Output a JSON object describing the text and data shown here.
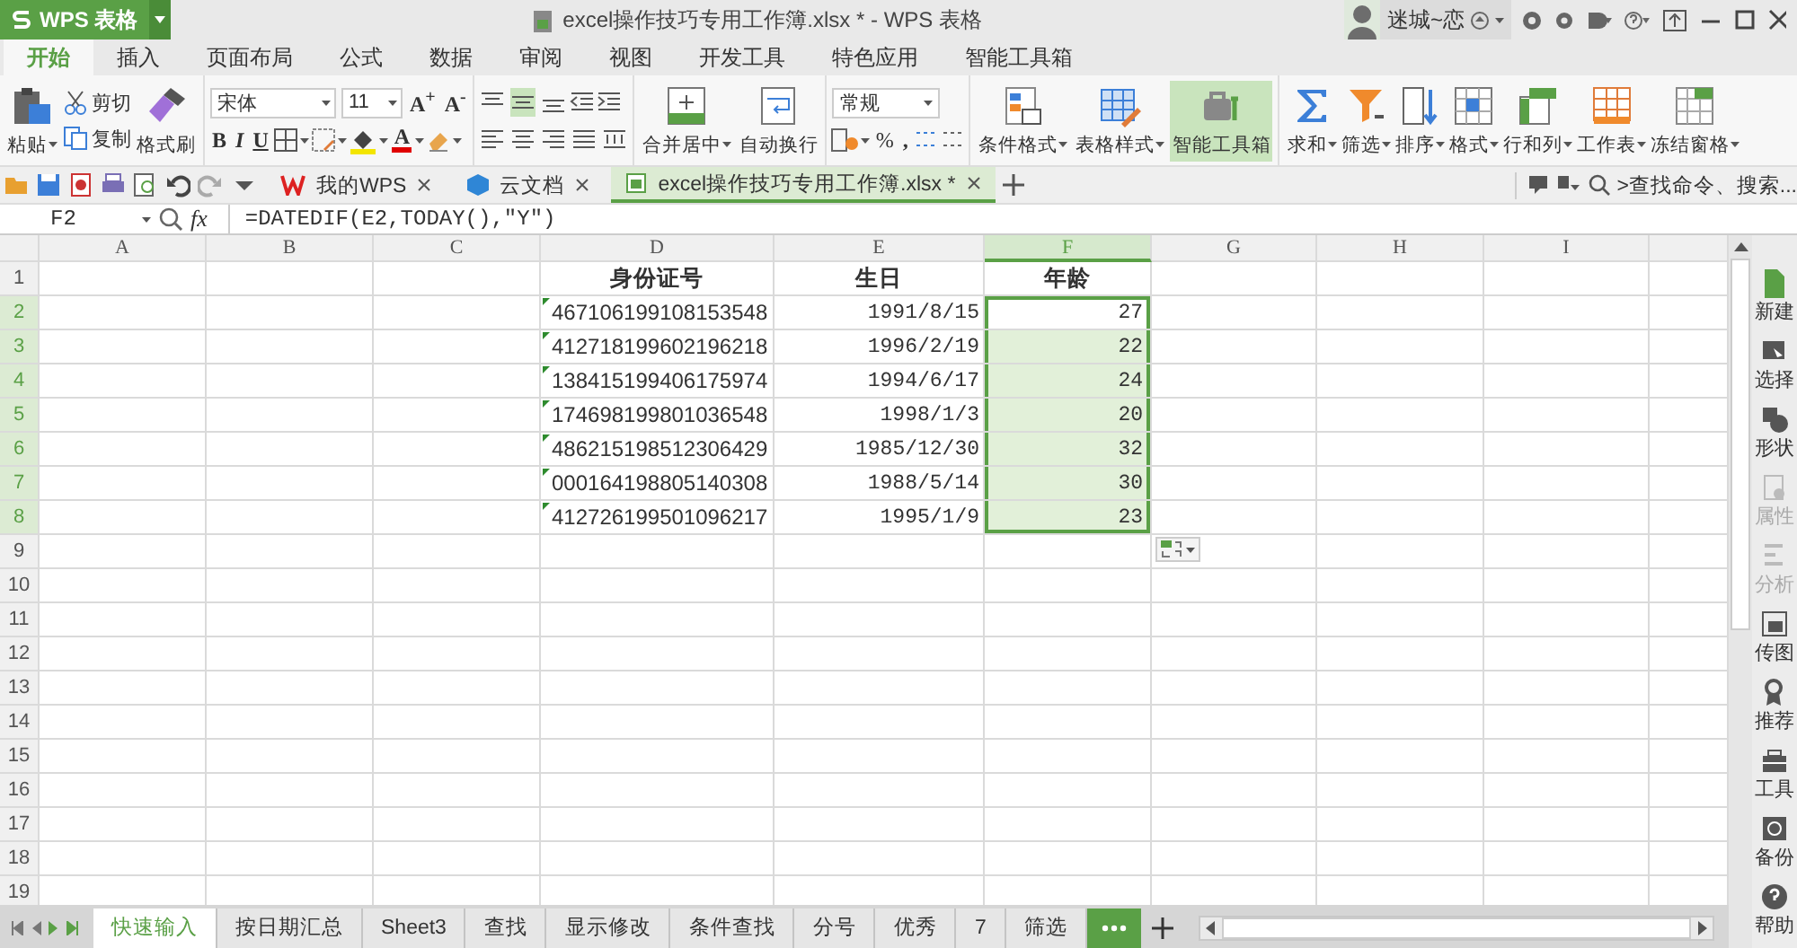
{
  "title_bar": {
    "app_button": "WPS 表格",
    "title": "excel操作技巧专用工作簿.xlsx * - WPS 表格",
    "user_name": "迷城~恋"
  },
  "menu_tabs": [
    {
      "label": "开始",
      "selected": true
    },
    {
      "label": "插入",
      "selected": false
    },
    {
      "label": "页面布局",
      "selected": false
    },
    {
      "label": "公式",
      "selected": false
    },
    {
      "label": "数据",
      "selected": false
    },
    {
      "label": "审阅",
      "selected": false
    },
    {
      "label": "视图",
      "selected": false
    },
    {
      "label": "开发工具",
      "selected": false
    },
    {
      "label": "特色应用",
      "selected": false
    },
    {
      "label": "智能工具箱",
      "selected": false
    }
  ],
  "ribbon": {
    "clipboard": {
      "paste": "粘贴",
      "cut": "剪切",
      "copy": "复制",
      "format_painter": "格式刷"
    },
    "font": {
      "family": "宋体",
      "size": "11",
      "grow": "A$^{+}$",
      "shrink": "A$^{-}$",
      "bold": "B",
      "italic": "I",
      "underline": "U",
      "font_color": "A"
    },
    "vertical_align": [
      {
        "selected": false
      },
      {
        "selected": true
      },
      {
        "selected": false
      }
    ],
    "merge": "合并居中",
    "wrap": "自动换行",
    "number": {
      "format": "常规",
      "percent": "%",
      "comma": ","
    },
    "style_buttons": [
      {
        "label": "条件格式",
        "dropdown": true,
        "highlighted": false
      },
      {
        "label": "表格样式",
        "dropdown": true,
        "highlighted": false
      },
      {
        "label": "智能工具箱",
        "dropdown": false,
        "highlighted": true
      }
    ],
    "edit_buttons": [
      "求和",
      "筛选",
      "排序",
      "格式",
      "行和列",
      "工作表",
      "冻结窗格"
    ]
  },
  "quick_bar": {
    "doc_tabs": [
      {
        "label": "我的WPS",
        "selected": false
      },
      {
        "label": "云文档",
        "selected": false
      },
      {
        "label": "excel操作技巧专用工作簿.xlsx *",
        "selected": true
      }
    ],
    "search": ">查找命令、搜索..."
  },
  "formula_bar": {
    "name_box": "F2",
    "fx": "fx",
    "formula": "=DATEDIF(E2,TODAY(),\"Y\")"
  },
  "sheet": {
    "columns": [
      {
        "label": "A",
        "selected": false
      },
      {
        "label": "B",
        "selected": false
      },
      {
        "label": "C",
        "selected": false
      },
      {
        "label": "D",
        "selected": false
      },
      {
        "label": "E",
        "selected": false
      },
      {
        "label": "F",
        "selected": true
      },
      {
        "label": "G",
        "selected": false
      },
      {
        "label": "H",
        "selected": false
      },
      {
        "label": "I",
        "selected": false
      }
    ],
    "row_headers": [
      {
        "label": "1",
        "selected": false
      },
      {
        "label": "2",
        "selected": true
      },
      {
        "label": "3",
        "selected": true
      },
      {
        "label": "4",
        "selected": true
      },
      {
        "label": "5",
        "selected": true
      },
      {
        "label": "6",
        "selected": true
      },
      {
        "label": "7",
        "selected": true
      },
      {
        "label": "8",
        "selected": true
      },
      {
        "label": "9",
        "selected": false
      },
      {
        "label": "10",
        "selected": false
      },
      {
        "label": "11",
        "selected": false
      },
      {
        "label": "12",
        "selected": false
      },
      {
        "label": "13",
        "selected": false
      },
      {
        "label": "14",
        "selected": false
      },
      {
        "label": "15",
        "selected": false
      },
      {
        "label": "16",
        "selected": false
      },
      {
        "label": "17",
        "selected": false
      },
      {
        "label": "18",
        "selected": false
      },
      {
        "label": "19",
        "selected": false
      }
    ],
    "header_row": [
      "身份证号",
      "生日",
      "年龄"
    ],
    "rows": [
      {
        "id_number": "467106199108153548",
        "text_flag": true,
        "birthday": "1991/8/15",
        "age": "27",
        "age_selected": true,
        "age_active": true
      },
      {
        "id_number": "412718199602196218",
        "text_flag": true,
        "birthday": "1996/2/19",
        "age": "22",
        "age_selected": true,
        "age_active": false
      },
      {
        "id_number": "138415199406175974",
        "text_flag": true,
        "birthday": "1994/6/17",
        "age": "24",
        "age_selected": true,
        "age_active": false
      },
      {
        "id_number": "174698199801036548",
        "text_flag": true,
        "birthday": "1998/1/3",
        "age": "20",
        "age_selected": true,
        "age_active": false
      },
      {
        "id_number": "486215198512306429",
        "text_flag": true,
        "birthday": "1985/12/30",
        "age": "32",
        "age_selected": true,
        "age_active": false
      },
      {
        "id_number": "000164198805140308",
        "text_flag": true,
        "birthday": "1988/5/14",
        "age": "30",
        "age_selected": true,
        "age_active": false
      },
      {
        "id_number": "412726199501096217",
        "text_flag": true,
        "birthday": "1995/1/9",
        "age": "23",
        "age_selected": true,
        "age_active": false
      }
    ]
  },
  "side_panel": [
    {
      "label": "新建",
      "disabled": false
    },
    {
      "label": "选择",
      "disabled": false
    },
    {
      "label": "形状",
      "disabled": false
    },
    {
      "label": "属性",
      "disabled": true
    },
    {
      "label": "分析",
      "disabled": true
    },
    {
      "label": "传图",
      "disabled": false
    },
    {
      "label": "推荐",
      "disabled": false
    },
    {
      "label": "工具",
      "disabled": false
    },
    {
      "label": "备份",
      "disabled": false
    },
    {
      "label": "帮助",
      "disabled": false
    }
  ],
  "sheet_tabs": [
    {
      "label": "快速输入",
      "selected": true
    },
    {
      "label": "按日期汇总",
      "selected": false
    },
    {
      "label": "Sheet3",
      "selected": false
    },
    {
      "label": "查找",
      "selected": false
    },
    {
      "label": "显示修改",
      "selected": false
    },
    {
      "label": "条件查找",
      "selected": false
    },
    {
      "label": "分号",
      "selected": false
    },
    {
      "label": "优秀",
      "selected": false
    },
    {
      "label": "7",
      "selected": false
    },
    {
      "label": "筛选",
      "selected": false
    }
  ]
}
